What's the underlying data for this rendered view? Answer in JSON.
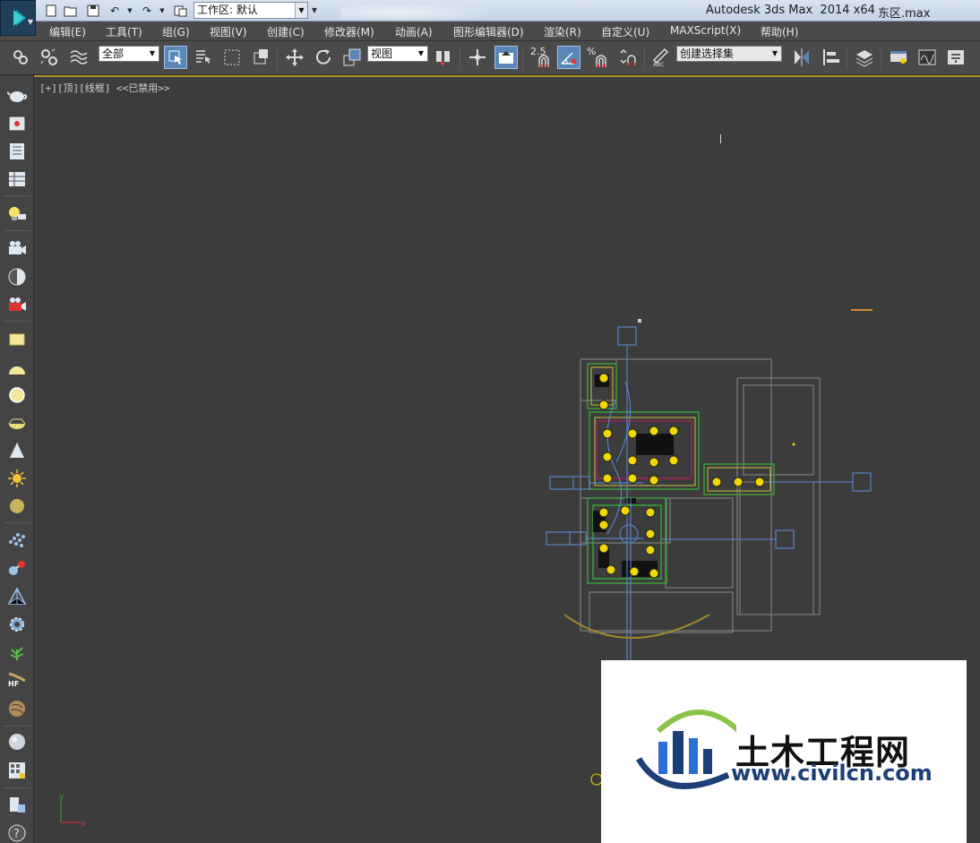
{
  "titlebar": {
    "app_title": "Autodesk 3ds Max  2014 x64",
    "file_name": "东区.max",
    "workspace": "工作区: 默认"
  },
  "quick_access": {
    "icons": [
      "new-file-icon",
      "open-file-icon",
      "save-icon",
      "undo-icon",
      "redo-icon",
      "project-folder-icon"
    ]
  },
  "menu": {
    "items": [
      "编辑(E)",
      "工具(T)",
      "组(G)",
      "视图(V)",
      "创建(C)",
      "修改器(M)",
      "动画(A)",
      "图形编辑器(D)",
      "渲染(R)",
      "自定义(U)",
      "MAXScript(X)",
      "帮助(H)"
    ]
  },
  "toolbar": {
    "selection_filter": "全部",
    "reference_coord": "视图",
    "named_selection": "创建选择集",
    "angle_snap_label": "2.5",
    "percent_snap_label": "%"
  },
  "viewport": {
    "label": "[+][顶][线框] <<已禁用>>",
    "axis_x": "x",
    "axis_y": "y"
  },
  "watermark": {
    "title": "土木工程网",
    "url": "www.civilcn.com"
  },
  "colors": {
    "viewport_bg": "#3c3c3c",
    "active_border": "#b5912a",
    "menu_bg": "#4a4a4a",
    "light_yellow": "#f0d800",
    "selection_blue": "#5a86b8"
  }
}
